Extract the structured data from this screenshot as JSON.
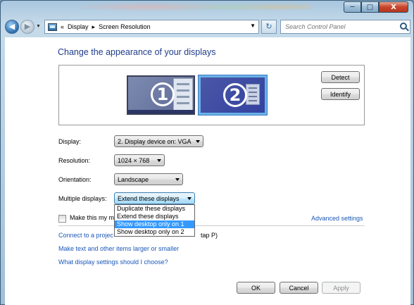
{
  "titlebar": {
    "buttons": {
      "minimize": "─",
      "maximize": "□",
      "close": "X"
    }
  },
  "navbar": {
    "back": "◀",
    "forward": "▶",
    "breadcrumb_prefix": "«",
    "breadcrumb": [
      "Display",
      "Screen Resolution"
    ],
    "breadcrumb_sep": "▸",
    "refresh": "↻",
    "search_placeholder": "Search Control Panel"
  },
  "main": {
    "title": "Change the appearance of your displays",
    "monitors": [
      "1",
      "2"
    ],
    "detect_label": "Detect",
    "identify_label": "Identify",
    "display_label": "Display:",
    "display_value": "2. Display device on: VGA",
    "resolution_label": "Resolution:",
    "resolution_value": "1024 × 768",
    "orientation_label": "Orientation:",
    "orientation_value": "Landscape",
    "multiple_label": "Multiple displays:",
    "multiple_value": "Extend these displays",
    "multiple_options": [
      "Duplicate these displays",
      "Extend these displays",
      "Show desktop only on 1",
      "Show desktop only on 2"
    ],
    "selected_option_index": 2,
    "make_main_label": "Make this my ma",
    "advanced_link": "Advanced settings",
    "connect_link_a": "Connect to a projec",
    "connect_link_b": "tap P)",
    "text_size_link": "Make text and other items larger or smaller",
    "help_link": "What display settings should I choose?",
    "ok_label": "OK",
    "cancel_label": "Cancel",
    "apply_label": "Apply"
  }
}
